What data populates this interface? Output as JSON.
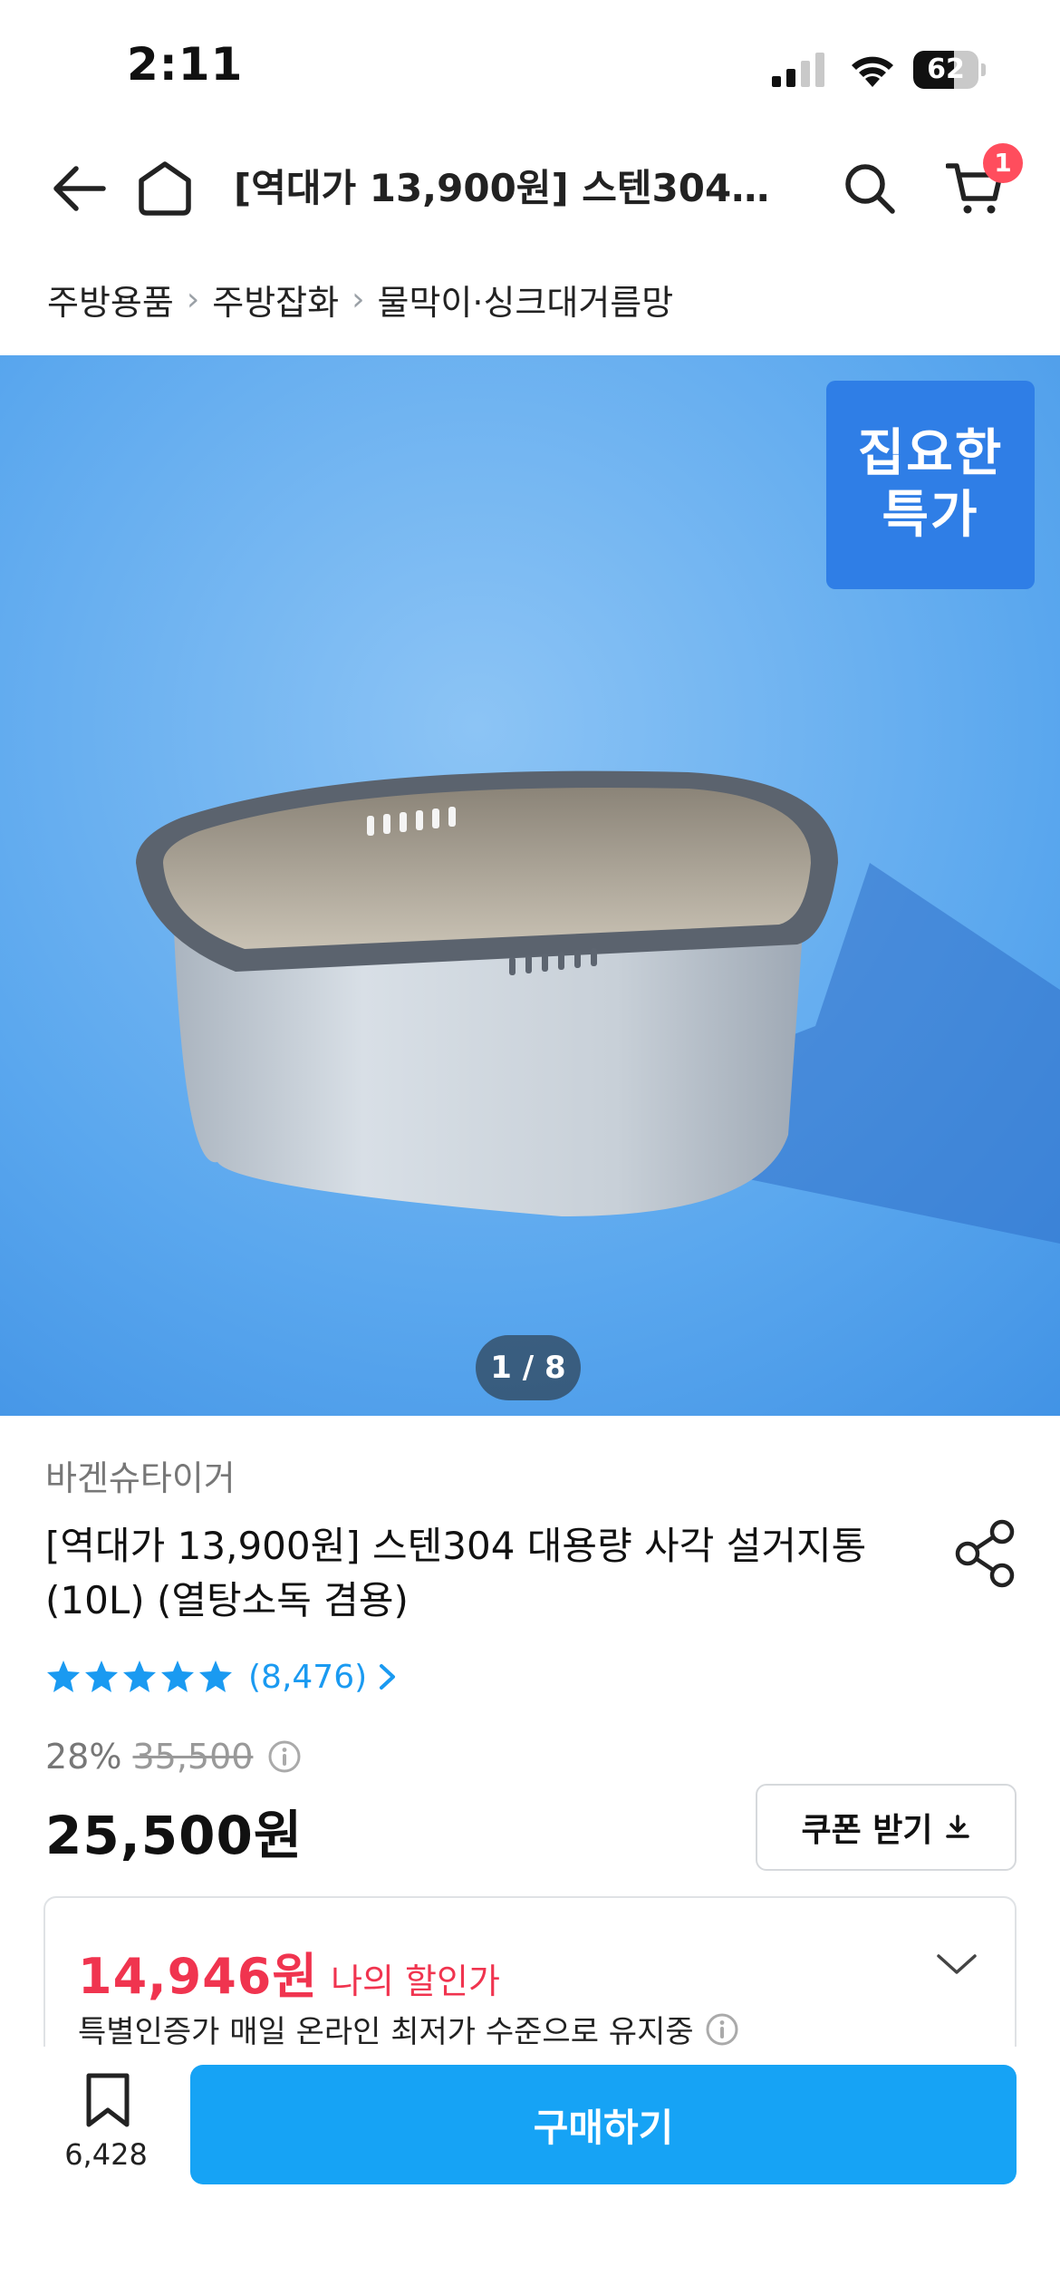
{
  "status_bar": {
    "time": "2:11",
    "battery": "62",
    "battery_level": 0.62
  },
  "header": {
    "title": "[역대가 13,900원] 스텐304 대용량 사각 설거지통 (10L) (열탕소독 겸용)",
    "cart_count": "1"
  },
  "breadcrumb": [
    "주방용품",
    "주방잡화",
    "물막이·싱크대거름망"
  ],
  "gallery": {
    "badge_line1": "집요한",
    "badge_line2": "특가",
    "counter": "1 / 8"
  },
  "product": {
    "brand": "바겐슈타이거",
    "title": "[역대가 13,900원] 스텐304 대용량 사각 설거지통 (10L) (열탕소독 겸용)",
    "rating_stars": 5,
    "review_count": "(8,476)",
    "discount": "28%",
    "original_price": "35,500",
    "price": "25,500원",
    "coupon_label": "쿠폰 받기"
  },
  "my_price": {
    "value": "14,946원",
    "label": "나의 할인가",
    "note": "특별인증가 매일 온라인 최저가 수준으로 유지중"
  },
  "bottom_bar": {
    "bookmark_count": "6,428",
    "buy_label": "구매하기"
  },
  "colors": {
    "accent": "#16a3f5",
    "badge_blue": "#2f7ee6",
    "sale_red": "#f0344f",
    "star": "#1a9af1"
  }
}
